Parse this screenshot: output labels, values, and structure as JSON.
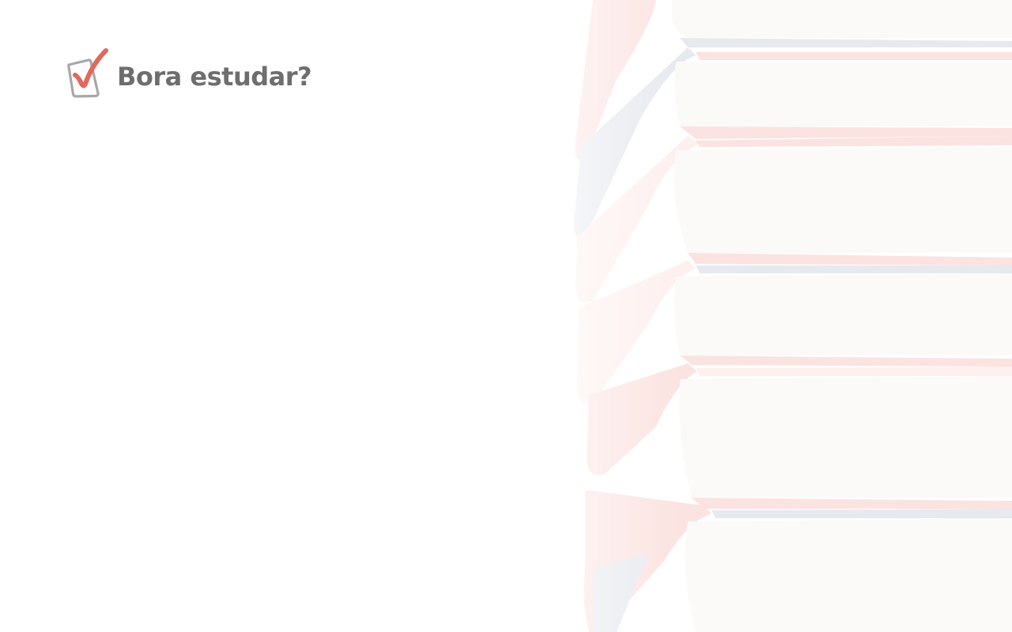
{
  "brand": {
    "name": "Bora estudar?",
    "icon": "checkbox-check-icon",
    "accent_color": "#e0685d",
    "box_color": "#a8a8a8",
    "text_color": "#6e6e6e"
  },
  "hero": {
    "image": "stacked-books-icon",
    "book_cover_colors": [
      "#fbe3e1",
      "#e6e9ee",
      "#fdf0ee"
    ],
    "page_color": "#fbfaf8"
  }
}
